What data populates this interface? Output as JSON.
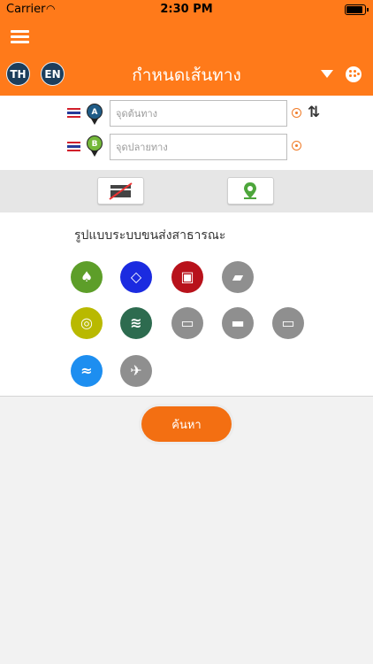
{
  "status_bar": {
    "carrier": "Carrier",
    "time": "2:30 PM"
  },
  "header": {
    "title": "กำหนดเส้นทาง",
    "lang_th": "TH",
    "lang_en": "EN"
  },
  "route": {
    "origin_pin": "A",
    "destination_pin": "B",
    "origin_placeholder": "จุดต้นทาง",
    "destination_placeholder": "จุดปลายทาง"
  },
  "transport": {
    "title": "รูปแบบระบบขนส่งสาธารณะ",
    "modes": [
      {
        "icon": "tree-icon",
        "color": "#5d9e29"
      },
      {
        "icon": "rail-link-icon",
        "color": "#1b2be0"
      },
      {
        "icon": "airport-train-icon",
        "color": "#b8121b"
      },
      {
        "icon": "steam-train-icon",
        "color": "#8f8f8f"
      },
      {
        "icon": "circle-line-icon",
        "color": "#b9b900"
      },
      {
        "icon": "highway-icon",
        "color": "#2d6b4f"
      },
      {
        "icon": "bus-icon",
        "color": "#8f8f8f"
      },
      {
        "icon": "coach-icon",
        "color": "#8f8f8f"
      },
      {
        "icon": "van-icon",
        "color": "#8f8f8f"
      },
      {
        "icon": "boat-icon",
        "color": "#1d8ef0"
      },
      {
        "icon": "plane-icon",
        "color": "#8f8f8f"
      }
    ]
  },
  "search_label": "ค้นหา"
}
